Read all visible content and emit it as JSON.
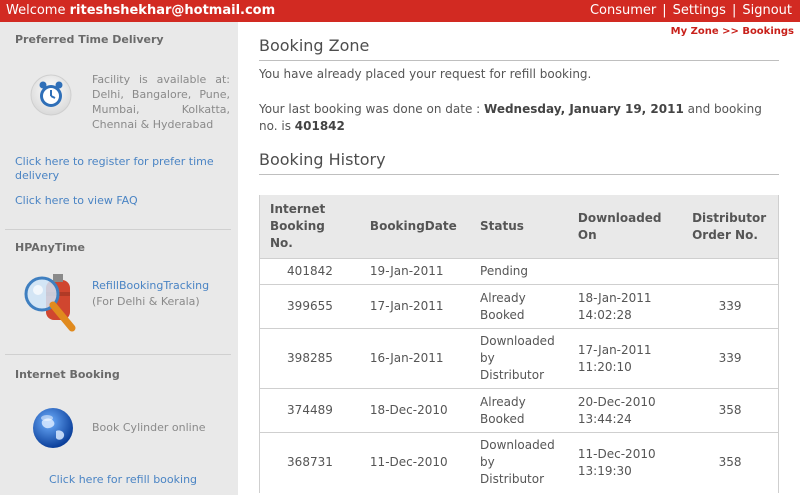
{
  "topbar": {
    "welcome_prefix": "Welcome",
    "user_email": "riteshshekhar@hotmail.com",
    "nav": [
      "Consumer",
      "Settings",
      "Signout"
    ],
    "color": "#d22a22"
  },
  "breadcrumb": "My Zone >> Bookings",
  "sidebar": {
    "preferred": {
      "title": "Preferred Time Delivery",
      "icon": "alarm-clock-icon",
      "text": "Facility is available at: Delhi, Bangalore, Pune, Mumbai, Kolkatta, Chennai & Hyderabad",
      "link_register": "Click here to register for prefer time delivery",
      "link_faq": "Click here to view FAQ"
    },
    "hpanytime": {
      "title": "HPAnyTime",
      "icon": "gas-cylinder-magnifier-icon",
      "link": "RefillBookingTracking",
      "note": "(For Delhi & Kerala)"
    },
    "internet": {
      "title": "Internet Booking",
      "icon": "globe-icon",
      "text": "Book Cylinder online",
      "link": "Click here for refill booking"
    }
  },
  "main": {
    "title": "Booking Zone",
    "msg_placed": "You have already placed your request for refill booking.",
    "last_prefix": "Your last booking was done on date :",
    "last_date": "Wednesday, January 19, 2011",
    "last_mid": "and booking no. is",
    "last_no": "401842",
    "history_title": "Booking History"
  },
  "table": {
    "headers": [
      "Internet Booking No.",
      "BookingDate",
      "Status",
      "Downloaded On",
      "Distributor Order No."
    ],
    "rows": [
      {
        "no": "401842",
        "date": "19-Jan-2011",
        "status": "Pending",
        "dl": "",
        "order": ""
      },
      {
        "no": "399655",
        "date": "17-Jan-2011",
        "status": "Already Booked",
        "dl": "18-Jan-2011 14:02:28",
        "order": "339"
      },
      {
        "no": "398285",
        "date": "16-Jan-2011",
        "status": "Downloaded by Distributor",
        "dl": "17-Jan-2011 11:20:10",
        "order": "339"
      },
      {
        "no": "374489",
        "date": "18-Dec-2010",
        "status": "Already Booked",
        "dl": "20-Dec-2010 13:44:24",
        "order": "358"
      },
      {
        "no": "368731",
        "date": "11-Dec-2010",
        "status": "Downloaded by Distributor",
        "dl": "11-Dec-2010 13:19:30",
        "order": "358"
      }
    ]
  }
}
